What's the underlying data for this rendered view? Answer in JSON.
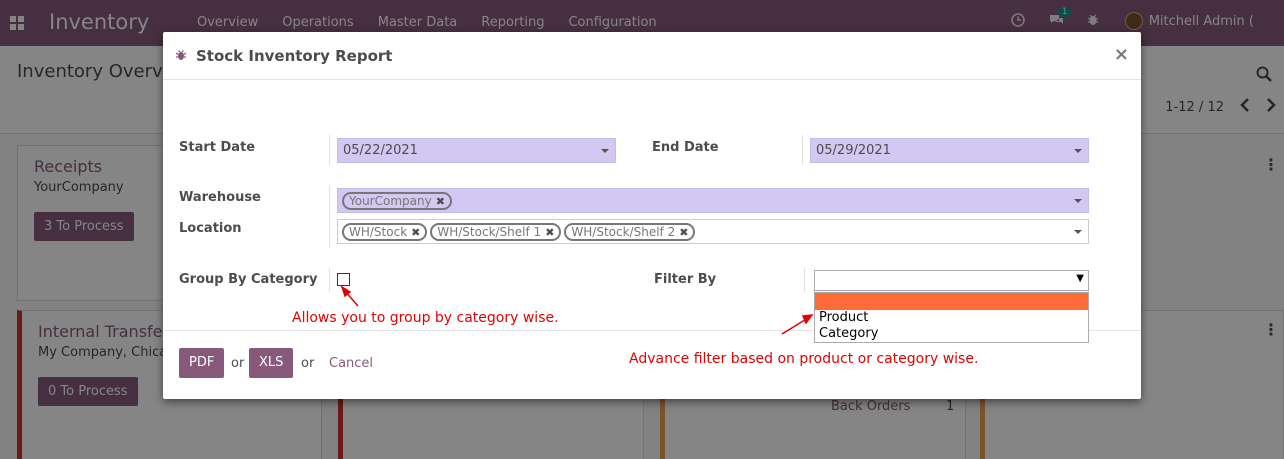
{
  "navbar": {
    "app_title": "Inventory",
    "menu": [
      "Overview",
      "Operations",
      "Master Data",
      "Reporting",
      "Configuration"
    ],
    "chat_count": "1",
    "user_name": "Mitchell Admin ("
  },
  "page": {
    "title": "Inventory Overview",
    "pager": "1-12 / 12"
  },
  "cards": {
    "receipts": {
      "title": "Receipts",
      "company": "YourCompany",
      "button": "3 To Process"
    },
    "internal": {
      "title": "Internal Transfers",
      "company": "My Company, Chicago",
      "button": "0 To Process"
    },
    "back_orders": {
      "label": "Back Orders",
      "count": "1"
    }
  },
  "dialog": {
    "title": "Stock Inventory Report",
    "close": "×",
    "start_date_label": "Start Date",
    "start_date": "05/22/2021",
    "end_date_label": "End Date",
    "end_date": "05/29/2021",
    "warehouse_label": "Warehouse",
    "warehouse_tags": [
      "YourCompany"
    ],
    "location_label": "Location",
    "location_tags": [
      "WH/Stock",
      "WH/Stock/Shelf 1",
      "WH/Stock/Shelf 2"
    ],
    "group_by_label": "Group By Category",
    "filter_by_label": "Filter By",
    "filter_options": [
      "",
      "Product",
      "Category"
    ],
    "pdf_button": "PDF",
    "or1": "or",
    "xls_button": "XLS",
    "or2": "or",
    "cancel": "Cancel"
  },
  "annotations": {
    "group_note": "Allows you to group by category wise.",
    "filter_note": "Advance filter based on product or category wise."
  },
  "colors": {
    "brand": "#875a7b",
    "required_field": "#d2c8f2",
    "annotation": "#e40000",
    "selected_option": "#ff6c37"
  }
}
